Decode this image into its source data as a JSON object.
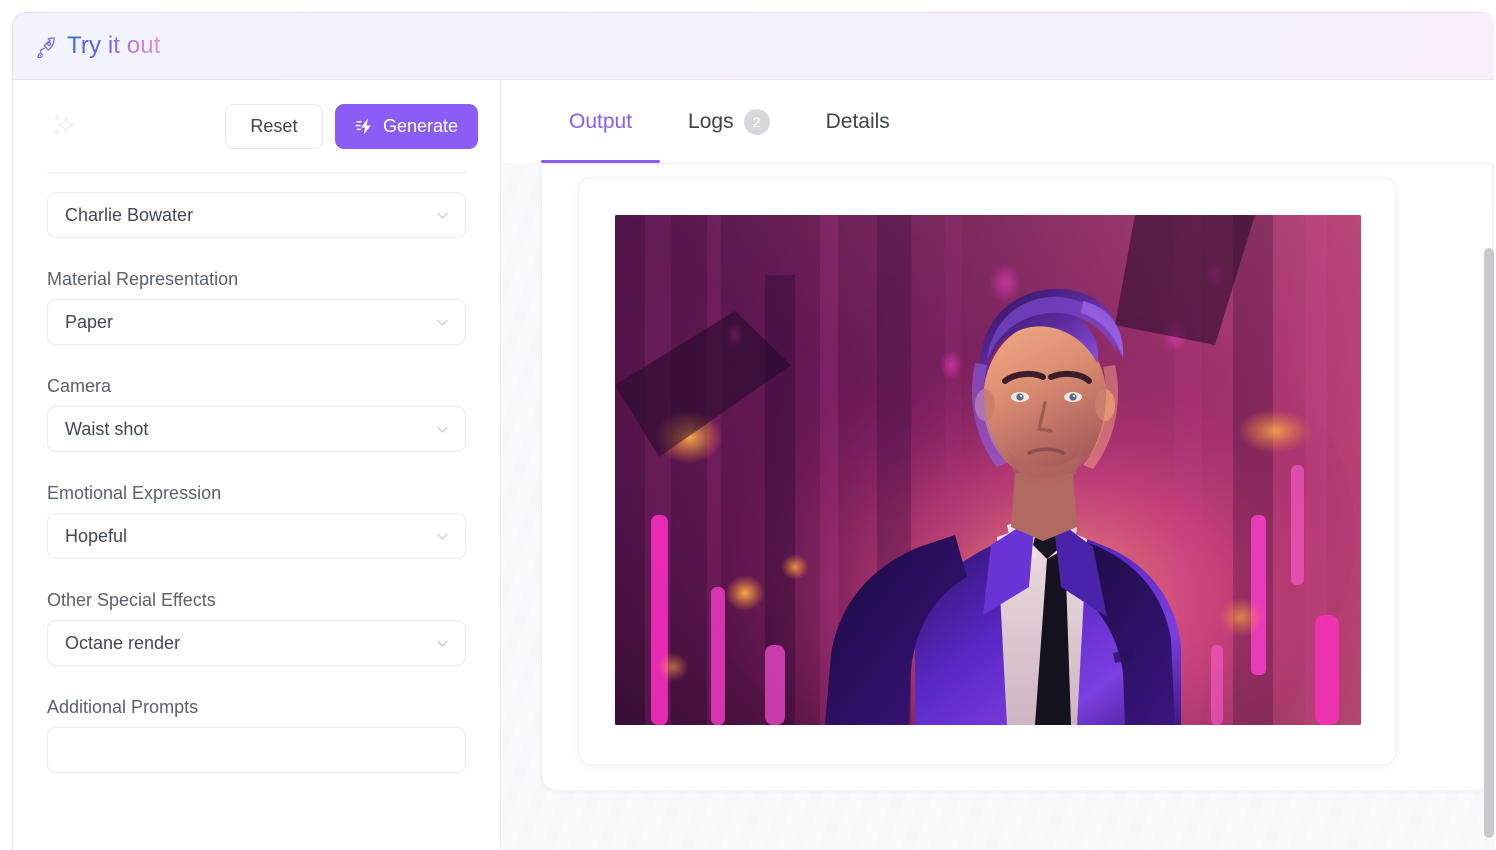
{
  "header": {
    "title": "Try it out",
    "title_part_primary": "Try it ",
    "title_part_accent": "out",
    "icon": "rocket-icon",
    "accent_color": "#8b5cf6",
    "gradient_from": "#3d6ce0",
    "gradient_to": "#e98fd4"
  },
  "left_panel": {
    "decor_icon": "sparkles-icon",
    "reset_label": "Reset",
    "generate_label": "Generate",
    "generate_icon": "lightning-bolt-icon",
    "generate_bg": "#8b5cf6",
    "fields": [
      {
        "label": "",
        "value": "Charlie Bowater",
        "name": "artist-style-select"
      },
      {
        "label": "Material Representation",
        "value": "Paper",
        "name": "material-representation-select"
      },
      {
        "label": "Camera",
        "value": "Waist shot",
        "name": "camera-select"
      },
      {
        "label": "Emotional Expression",
        "value": "Hopeful",
        "name": "emotional-expression-select"
      },
      {
        "label": "Other Special Effects",
        "value": "Octane render",
        "name": "other-special-effects-select"
      },
      {
        "label": "Additional Prompts",
        "value": "",
        "name": "additional-prompts-input"
      }
    ]
  },
  "right_panel": {
    "tabs": [
      {
        "label": "Output",
        "active": true,
        "badge": ""
      },
      {
        "label": "Logs",
        "active": false,
        "badge": "2"
      },
      {
        "label": "Details",
        "active": false,
        "badge": ""
      }
    ],
    "output": {
      "image_alt": "Generated portrait of a man in a purple suit against a neon pink and magenta city backdrop"
    }
  },
  "scrollbar": {
    "name": "page-vertical-scrollbar",
    "thumb_color": "#c9cad0"
  }
}
